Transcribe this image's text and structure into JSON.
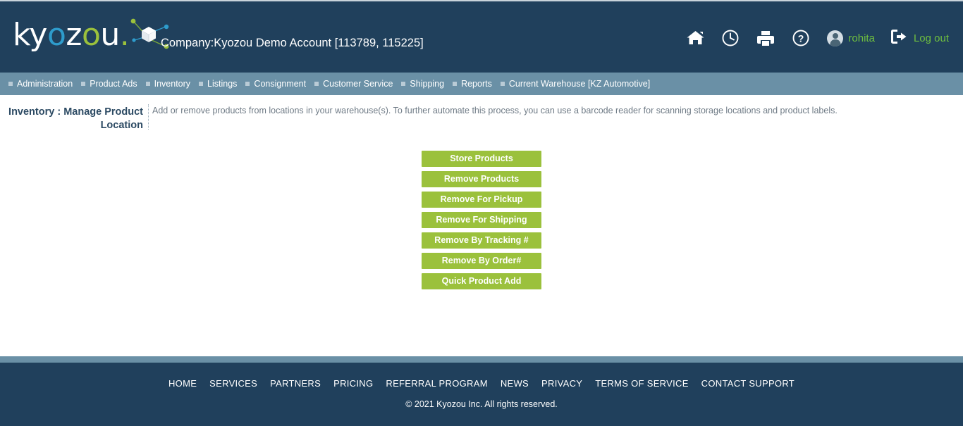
{
  "brand": {
    "name_parts": [
      "ky",
      "o",
      "z",
      "o",
      "u"
    ],
    "logo_text_1": "ky",
    "logo_text_o1": "o",
    "logo_text_z": "z",
    "logo_text_o2": "o",
    "logo_text_u": "u",
    "logo_dot": ".",
    "colors": {
      "header_bg": "#20405c",
      "nav_bg": "#6a90a6",
      "accent_green": "#9bc13c",
      "link_green": "#6fbf3f",
      "logo_blue": "#2e9ccc",
      "title_blue": "#2c4a63"
    }
  },
  "header": {
    "company_label": "Company:Kyozou Demo Account [113789, 115225]",
    "tools": [
      {
        "icon": "home-icon",
        "name": "home"
      },
      {
        "icon": "clock-icon",
        "name": "history"
      },
      {
        "icon": "printer-icon",
        "name": "print"
      },
      {
        "icon": "help-icon",
        "name": "help"
      }
    ],
    "user_name": "rohita",
    "logout_label": "Log out"
  },
  "nav": {
    "items": [
      {
        "label": "Administration"
      },
      {
        "label": "Product Ads"
      },
      {
        "label": "Inventory"
      },
      {
        "label": "Listings"
      },
      {
        "label": "Consignment"
      },
      {
        "label": "Customer Service"
      },
      {
        "label": "Shipping"
      },
      {
        "label": "Reports"
      },
      {
        "label": "Current Warehouse [KZ Automotive]"
      }
    ]
  },
  "page": {
    "title": "Inventory : Manage Product Location",
    "description": "Add or remove products from locations in your warehouse(s). To further automate this process, you can use a barcode reader for scanning storage locations and product labels."
  },
  "actions": {
    "buttons": [
      {
        "label": "Store Products"
      },
      {
        "label": "Remove Products"
      },
      {
        "label": "Remove For Pickup"
      },
      {
        "label": "Remove For Shipping"
      },
      {
        "label": "Remove By Tracking #"
      },
      {
        "label": "Remove By Order#"
      },
      {
        "label": "Quick Product Add"
      }
    ]
  },
  "footer": {
    "links": [
      {
        "label": "HOME"
      },
      {
        "label": "SERVICES"
      },
      {
        "label": "PARTNERS"
      },
      {
        "label": "PRICING"
      },
      {
        "label": "REFERRAL PROGRAM"
      },
      {
        "label": "NEWS"
      },
      {
        "label": "PRIVACY"
      },
      {
        "label": "TERMS OF SERVICE"
      },
      {
        "label": "CONTACT SUPPORT"
      }
    ],
    "copyright": "© 2021 Kyozou Inc. All rights reserved."
  }
}
